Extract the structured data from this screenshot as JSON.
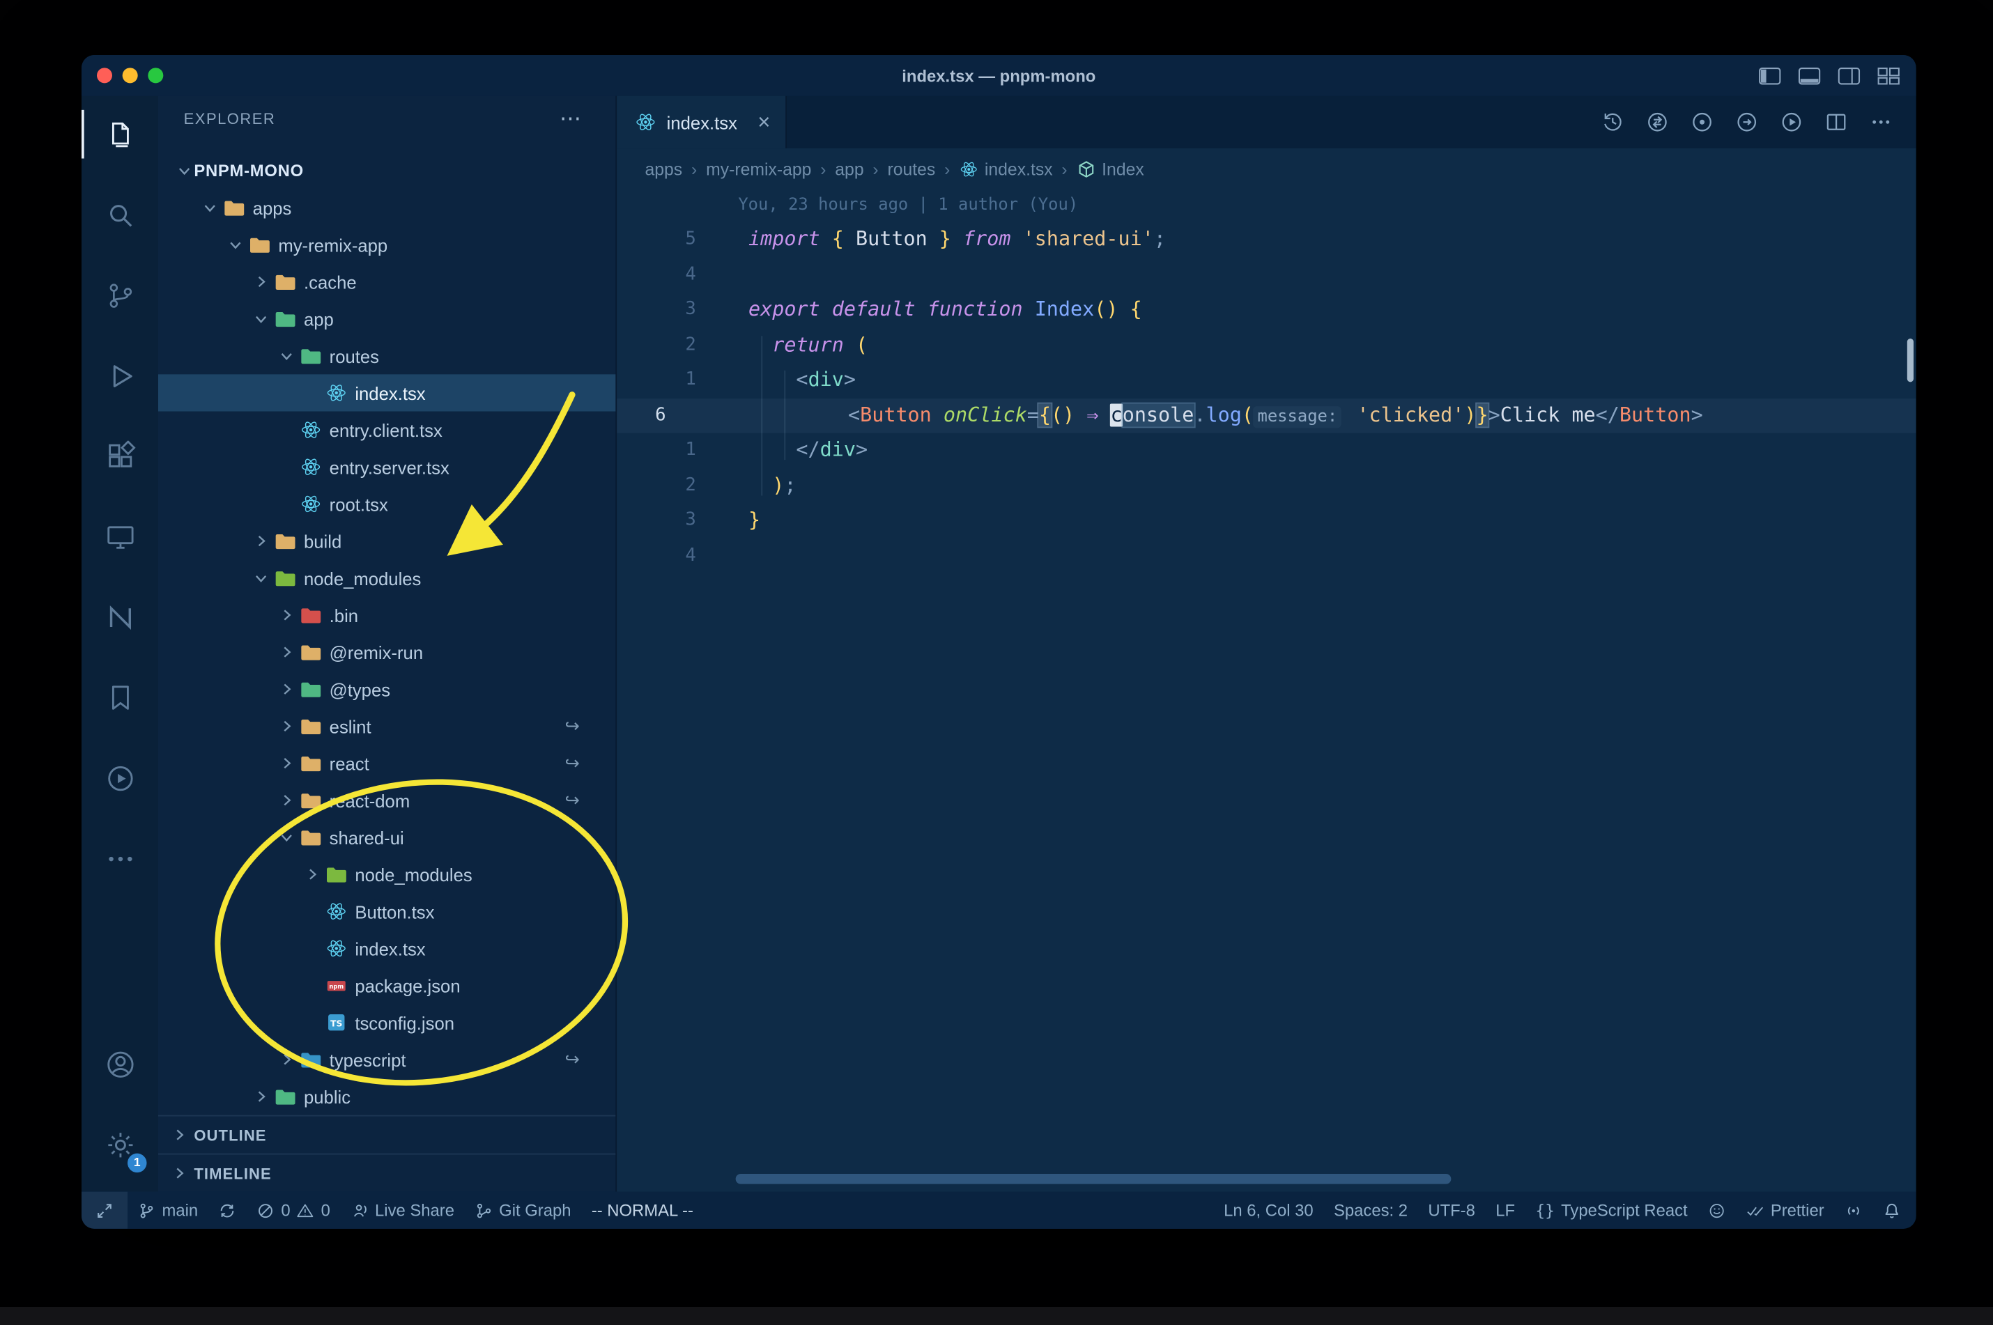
{
  "window": {
    "title": "index.tsx — pnpm-mono"
  },
  "glyphs": {
    "close": "×",
    "sep": "›",
    "more": "⋯",
    "symlink": "↪"
  },
  "colors": {
    "annotation_yellow": "#f5e636",
    "selected_row": "#1d4466",
    "react_icon": "#5fd4f4",
    "npm_icon": "#c9474d",
    "ts_icon": "#3b9cd1",
    "settings_badge": "#2f86d1",
    "editor_background": "#0e2b47"
  },
  "titlebar": {
    "layout_icons": [
      "toggle-panel-left",
      "toggle-panel-bottom",
      "toggle-panel-right",
      "customize-layout"
    ]
  },
  "activity_bar": {
    "top": [
      {
        "name": "explorer",
        "icon": "files",
        "active": true
      },
      {
        "name": "search",
        "icon": "search"
      },
      {
        "name": "source-control",
        "icon": "scm"
      },
      {
        "name": "run-debug",
        "icon": "debug"
      },
      {
        "name": "extensions",
        "icon": "extensions"
      },
      {
        "name": "remote-explorer",
        "icon": "remote-explorer"
      },
      {
        "name": "nx-console",
        "icon": "nx"
      },
      {
        "name": "bookmarks",
        "icon": "bookmark"
      },
      {
        "name": "gitlens",
        "icon": "circle-play"
      },
      {
        "name": "more-views",
        "icon": "ellipsis"
      }
    ],
    "bottom": [
      {
        "name": "accounts",
        "icon": "account"
      },
      {
        "name": "settings",
        "icon": "gear",
        "badge": "1"
      }
    ]
  },
  "sidebar": {
    "header": {
      "title": "EXPLORER",
      "more": "⋯"
    },
    "outline_label": "OUTLINE",
    "timeline_label": "TIMELINE",
    "tree": [
      {
        "label": "PNPM-MONO",
        "depth": 0,
        "chevron": "down",
        "root": true
      },
      {
        "label": "apps",
        "depth": 1,
        "chevron": "down",
        "folder": "#deb068"
      },
      {
        "label": "my-remix-app",
        "depth": 2,
        "chevron": "down",
        "folder": "#deb068"
      },
      {
        "label": ".cache",
        "depth": 3,
        "chevron": "right",
        "folder": "#deb068"
      },
      {
        "label": "app",
        "depth": 3,
        "chevron": "down",
        "folder": "#4fb883"
      },
      {
        "label": "routes",
        "depth": 4,
        "chevron": "down",
        "folder": "#4fb883"
      },
      {
        "label": "index.tsx",
        "depth": 5,
        "file": "react",
        "selected": true
      },
      {
        "label": "entry.client.tsx",
        "depth": 4,
        "file": "react"
      },
      {
        "label": "entry.server.tsx",
        "depth": 4,
        "file": "react"
      },
      {
        "label": "root.tsx",
        "depth": 4,
        "file": "react"
      },
      {
        "label": "build",
        "depth": 3,
        "chevron": "right",
        "folder": "#deb068"
      },
      {
        "label": "node_modules",
        "depth": 3,
        "chevron": "down",
        "folder": "#7cb93f"
      },
      {
        "label": ".bin",
        "depth": 4,
        "chevron": "right",
        "folder": "#d4504c"
      },
      {
        "label": "@remix-run",
        "depth": 4,
        "chevron": "right",
        "folder": "#deb068"
      },
      {
        "label": "@types",
        "depth": 4,
        "chevron": "right",
        "folder": "#4fb883"
      },
      {
        "label": "eslint",
        "depth": 4,
        "chevron": "right",
        "folder": "#deb068",
        "symlink": true
      },
      {
        "label": "react",
        "depth": 4,
        "chevron": "right",
        "folder": "#deb068",
        "symlink": true
      },
      {
        "label": "react-dom",
        "depth": 4,
        "chevron": "right",
        "folder": "#deb068",
        "symlink": true
      },
      {
        "label": "shared-ui",
        "depth": 4,
        "chevron": "down",
        "folder": "#deb068"
      },
      {
        "label": "node_modules",
        "depth": 5,
        "chevron": "right",
        "folder": "#7cb93f"
      },
      {
        "label": "Button.tsx",
        "depth": 5,
        "file": "react"
      },
      {
        "label": "index.tsx",
        "depth": 5,
        "file": "react"
      },
      {
        "label": "package.json",
        "depth": 5,
        "file": "npm"
      },
      {
        "label": "tsconfig.json",
        "depth": 5,
        "file": "ts"
      },
      {
        "label": "typescript",
        "depth": 4,
        "chevron": "right",
        "folder": "#3693c6",
        "symlink": true
      },
      {
        "label": "public",
        "depth": 3,
        "chevron": "right",
        "folder": "#4fb883"
      }
    ]
  },
  "editor": {
    "tab": {
      "label": "index.tsx",
      "icon": "react"
    },
    "toolbar": [
      "history",
      "compare",
      "circle-dot",
      "circle-arrow",
      "play-circle2",
      "split",
      "more-h"
    ],
    "breadcrumbs": [
      {
        "label": "apps"
      },
      {
        "label": "my-remix-app"
      },
      {
        "label": "app"
      },
      {
        "label": "routes"
      },
      {
        "label": "index.tsx",
        "icon": "react"
      },
      {
        "label": "Index",
        "icon": "symbol"
      }
    ],
    "blame": "You, 23 hours ago | 1 author (You)",
    "code": {
      "lines": [
        {
          "num": "5",
          "tokens": [
            [
              "import",
              "kw"
            ],
            [
              " "
            ],
            [
              "{",
              "brk"
            ],
            [
              " Button ",
              "txt"
            ],
            [
              "}",
              "brk"
            ],
            [
              " "
            ],
            [
              "from",
              "kw"
            ],
            [
              " "
            ],
            [
              "'shared-ui'",
              "str"
            ],
            [
              ";",
              "pun"
            ]
          ]
        },
        {
          "num": "4",
          "tokens": []
        },
        {
          "num": "3",
          "tokens": [
            [
              "export",
              "kw"
            ],
            [
              " "
            ],
            [
              "default",
              "kw"
            ],
            [
              " "
            ],
            [
              "function",
              "kw"
            ],
            [
              " "
            ],
            [
              "Index",
              "fn"
            ],
            [
              "()",
              "brk"
            ],
            [
              " "
            ],
            [
              "{",
              "brk"
            ]
          ]
        },
        {
          "num": "2",
          "tokens": [
            [
              "  "
            ],
            [
              "return",
              "kw"
            ],
            [
              " "
            ],
            [
              "(",
              "brk"
            ]
          ]
        },
        {
          "num": "1",
          "tokens": [
            [
              "    "
            ],
            [
              "<",
              "pun"
            ],
            [
              "div",
              "tag"
            ],
            [
              ">",
              "pun"
            ]
          ]
        },
        {
          "num": "6",
          "current": true,
          "tokens": [
            [
              "      "
            ],
            [
              "<",
              "pun"
            ],
            [
              "Button",
              "comp"
            ],
            [
              " "
            ],
            [
              "onClick",
              "attr"
            ],
            [
              "=",
              "pun"
            ],
            [
              "{",
              "brkbox"
            ],
            [
              "()",
              "brk"
            ],
            [
              " "
            ],
            [
              "⇒",
              "arrow"
            ],
            [
              " "
            ],
            [
              "c",
              "cursor"
            ],
            [
              "onsole",
              "wordhl"
            ],
            [
              ".",
              "pun"
            ],
            [
              "log",
              "fn"
            ],
            [
              "(",
              "brk"
            ],
            [
              "message:",
              "hint"
            ],
            [
              " "
            ],
            [
              "'clicked'",
              "str"
            ],
            [
              ")",
              "brk"
            ],
            [
              "}",
              "brkbox"
            ],
            [
              ">",
              "pun"
            ],
            [
              "Click me",
              "txt"
            ],
            [
              "</",
              "pun"
            ],
            [
              "Button",
              "comp"
            ],
            [
              ">",
              "pun"
            ]
          ]
        },
        {
          "num": "1",
          "tokens": [
            [
              "    "
            ],
            [
              "</",
              "pun"
            ],
            [
              "div",
              "tag"
            ],
            [
              ">",
              "pun"
            ]
          ]
        },
        {
          "num": "2",
          "tokens": [
            [
              "  "
            ],
            [
              ")",
              "brk"
            ],
            [
              ";",
              "pun"
            ]
          ]
        },
        {
          "num": "3",
          "tokens": [
            [
              "}",
              "brk"
            ]
          ]
        },
        {
          "num": "4",
          "tokens": []
        }
      ]
    }
  },
  "status_bar": {
    "left": [
      {
        "name": "remote-indicator",
        "icon": "remote",
        "boxed": true
      },
      {
        "name": "git-branch",
        "icon": "branch",
        "text": "main"
      },
      {
        "name": "sync-changes",
        "icon": "sync"
      },
      {
        "name": "problems",
        "icon": "error",
        "text": "0",
        "icon2": "warning",
        "text2": "0"
      },
      {
        "name": "live-share",
        "icon": "live-share",
        "text": "Live Share"
      },
      {
        "name": "git-graph",
        "icon": "git-graph",
        "text": "Git Graph"
      },
      {
        "name": "vim-mode",
        "text": "-- NORMAL --"
      }
    ],
    "right": [
      {
        "name": "cursor-position",
        "text": "Ln 6, Col 30"
      },
      {
        "name": "indentation",
        "text": "Spaces: 2"
      },
      {
        "name": "encoding",
        "text": "UTF-8"
      },
      {
        "name": "eol",
        "text": "LF"
      },
      {
        "name": "language-mode",
        "icon": "braces",
        "text": "TypeScript React"
      },
      {
        "name": "feedback",
        "icon": "smiley"
      },
      {
        "name": "formatter",
        "icon": "double-check",
        "text": "Prettier"
      },
      {
        "name": "screencast",
        "icon": "broadcast"
      },
      {
        "name": "notifications",
        "icon": "bell"
      }
    ]
  }
}
